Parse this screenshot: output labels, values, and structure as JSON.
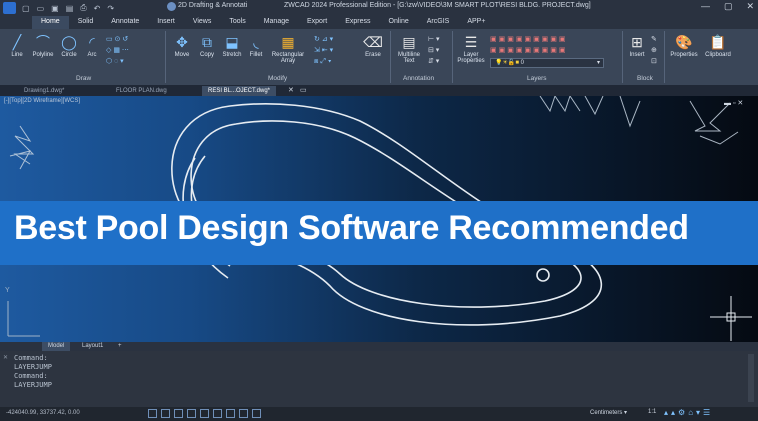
{
  "titlebar": {
    "workspace": "2D Drafting & Annotati",
    "window_title": "ZWCAD 2024 Professional Edition - [G:\\zw\\VIDEO\\3M SMART PLOT\\RESI BLDG. PROJECT.dwg]",
    "controls": [
      "—",
      "▢",
      "✕"
    ]
  },
  "menu_tabs": [
    "Home",
    "Solid",
    "Annotate",
    "Insert",
    "Views",
    "Tools",
    "Manage",
    "Export",
    "Express",
    "Online",
    "ArcGIS",
    "APP+"
  ],
  "active_tab": "Home",
  "ribbon": {
    "draw": {
      "label": "Draw",
      "tools": [
        "Line",
        "Polyline",
        "Circle",
        "Arc"
      ]
    },
    "modify": {
      "label": "Modify",
      "tools": [
        "Move",
        "Copy",
        "Stretch",
        "Fillet",
        "Rectangular Array",
        "Erase"
      ]
    },
    "annotation": {
      "label": "Annotation",
      "tools": [
        "Multiline Text"
      ]
    },
    "layers": {
      "label": "Layers",
      "tools": [
        "Layer Properties"
      ],
      "current_layer": "0"
    },
    "block": {
      "label": "Block",
      "tools": [
        "Insert"
      ]
    },
    "other": [
      "Properties",
      "Clipboard"
    ]
  },
  "doc_tabs": [
    "Drawing1.dwg*",
    "FLOOR PLAN.dwg",
    "RESI BL...OJECT.dwg*"
  ],
  "active_doc": "RESI BL...OJECT.dwg*",
  "viewport_label": "[-][Top][2D Wireframe][WCS]",
  "banner_text": "Best Pool Design Software Recommended",
  "axis_label": "Y",
  "layout_tabs": [
    "Model",
    "Layout1",
    "+"
  ],
  "command_history": "Command:\nLAYERJUMP\nCommand:\nLAYERJUMP",
  "status": {
    "coordinates": "-424040.99, 33737.42, 0.00",
    "units": "Centimeters",
    "scale": "1:1"
  },
  "colors": {
    "banner": "#1f70c8",
    "ribbon": "#3a4658",
    "accent": "#7fc3ff"
  }
}
